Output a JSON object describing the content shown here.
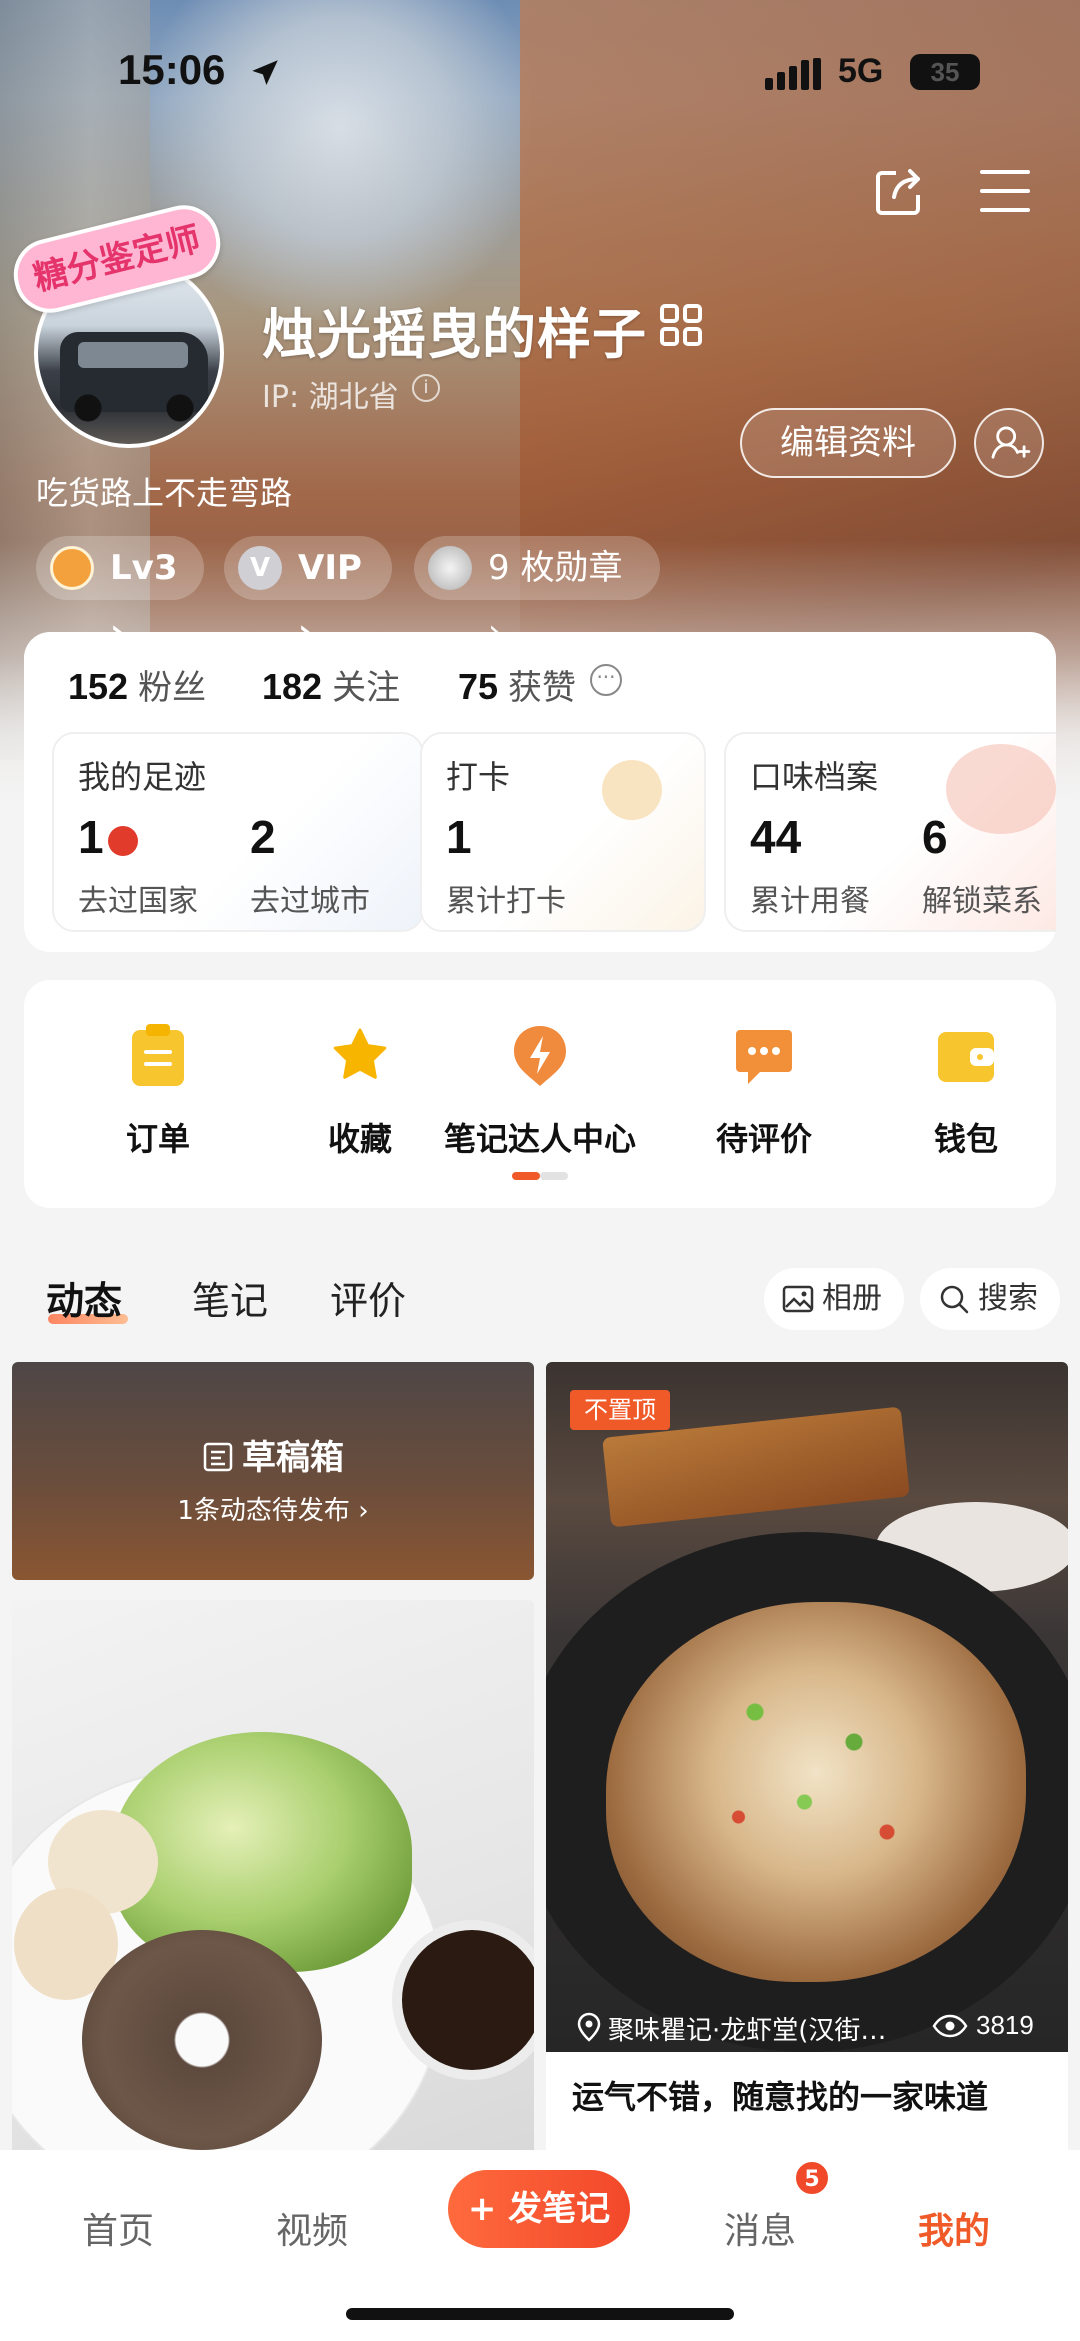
{
  "status_bar": {
    "time": "15:06",
    "network": "5G",
    "battery": "35"
  },
  "profile": {
    "avatar_badge": "糖分鉴定师",
    "nickname": "烛光摇曳的样子",
    "ip": "IP: 湖北省",
    "edit_label": "编辑资料",
    "bio": "吃货路上不走弯路",
    "chips": {
      "level": "Lv3 ›",
      "vip": "VIP ›",
      "vip_icon": "V",
      "badges": "9 枚勋章 ›"
    }
  },
  "stats": {
    "followers": {
      "value": "152",
      "label": "粉丝"
    },
    "following": {
      "value": "182",
      "label": "关注"
    },
    "likes": {
      "value": "75",
      "label": "获赞"
    }
  },
  "mini_cards": {
    "footprint": {
      "title": "我的足迹",
      "n1": "1",
      "l1": "去过国家",
      "n2": "2",
      "l2": "去过城市"
    },
    "checkin": {
      "title": "打卡",
      "n1": "1",
      "l1": "累计打卡"
    },
    "taste": {
      "title": "口味档案",
      "n1": "44",
      "l1": "累计用餐",
      "n2": "6",
      "l2": "解锁菜系"
    }
  },
  "services": [
    {
      "label": "订单",
      "icon": "clipboard-icon",
      "color": "#f7c52e"
    },
    {
      "label": "收藏",
      "icon": "star-icon",
      "color": "#f7b500"
    },
    {
      "label": "笔记达人中心",
      "icon": "lightning-badge-icon",
      "color": "#f08a3c"
    },
    {
      "label": "待评价",
      "icon": "chat-dots-icon",
      "color": "#f2903a"
    },
    {
      "label": "钱包",
      "icon": "wallet-icon",
      "color": "#f7c52e"
    }
  ],
  "tabs": [
    "动态",
    "笔记",
    "评价"
  ],
  "tab_buttons": {
    "album": "相册",
    "search": "搜索"
  },
  "feed": {
    "draft": {
      "title": "草稿箱",
      "subtitle": "1条动态待发布 ›"
    },
    "post": {
      "pin_label": "不置顶",
      "location": "聚味瞿记·龙虾堂(汉街…",
      "views": "3819",
      "caption": "运气不错，随意找的一家味道"
    }
  },
  "bottom_nav": {
    "home": "首页",
    "video": "视频",
    "post": "+ 发笔记",
    "messages": "消息",
    "messages_badge": "5",
    "me": "我的"
  },
  "colors": {
    "accent": "#f05a28",
    "card": "#ffffff",
    "background": "#f4f4f4"
  }
}
